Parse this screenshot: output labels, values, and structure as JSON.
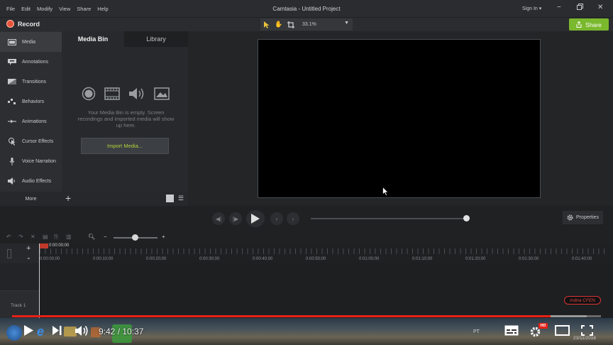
{
  "menu": {
    "items": [
      "File",
      "Edit",
      "Modify",
      "View",
      "Share",
      "Help"
    ]
  },
  "app": {
    "title": "Camtasia - Untitled Project"
  },
  "account": {
    "sign_in": "Sign In ▾"
  },
  "record": {
    "label": "Record"
  },
  "canvas_tools": {
    "zoom": "33.1%"
  },
  "share": {
    "label": "Share"
  },
  "sidebar": {
    "items": [
      {
        "label": "Media",
        "icon": "film-strip-icon"
      },
      {
        "label": "Annotations",
        "icon": "annotation-icon"
      },
      {
        "label": "Transitions",
        "icon": "transition-icon"
      },
      {
        "label": "Behaviors",
        "icon": "behaviors-icon"
      },
      {
        "label": "Animations",
        "icon": "animation-icon"
      },
      {
        "label": "Cursor Effects",
        "icon": "cursor-effects-icon"
      },
      {
        "label": "Voice Narration",
        "icon": "microphone-icon"
      },
      {
        "label": "Audio Effects",
        "icon": "speaker-icon"
      }
    ],
    "more_label": "More"
  },
  "media_bin": {
    "tabs": [
      "Media Bin",
      "Library"
    ],
    "empty_text": "Your Media Bin is empty. Screen recordings and imported media will show up here.",
    "import_label": "Import Media..."
  },
  "properties": {
    "label": "Properties"
  },
  "timeline": {
    "playhead_time": "0:00:00;00",
    "tick_labels": [
      "0:00:00;00",
      "0:00:10;00",
      "0:00:20;00",
      "0:00:30;00",
      "0:00:40;00",
      "0:00:50;00",
      "0:01:00;00",
      "0:01:10;00",
      "0:01:20;00",
      "0:01:30;00",
      "0:01:40;00"
    ],
    "track_label": "Track 1",
    "watermark": "mdna CFEN"
  },
  "player": {
    "time": "9:42 / 10:37",
    "progress": 0.914,
    "lang": "PT",
    "date": "23/11/2016",
    "hd": "HD"
  },
  "colors": {
    "accent": "#7ab82e",
    "record": "#e8533c",
    "youtube_red": "#e62117",
    "import_text": "#b5d33c"
  }
}
